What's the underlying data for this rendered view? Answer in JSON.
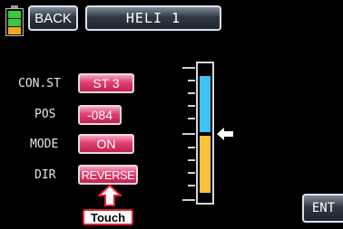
{
  "header": {
    "back_label": "BACK",
    "title": "HELI 1"
  },
  "battery": {
    "level_cells": 3,
    "colors": [
      "#39c93a",
      "#39c93a",
      "#f0a81a"
    ]
  },
  "rows": [
    {
      "label": "CON.ST",
      "value": "ST 3"
    },
    {
      "label": "POS",
      "value": "-084"
    },
    {
      "label": "MODE",
      "value": "ON"
    },
    {
      "label": "DIR",
      "value": "REVERSE"
    }
  ],
  "callout": {
    "label": "Touch",
    "color": "#e0242e"
  },
  "gauge": {
    "top_color": "#3ec3f0",
    "bottom_color": "#f7c23d"
  },
  "footer": {
    "ent_label": "ENT"
  }
}
